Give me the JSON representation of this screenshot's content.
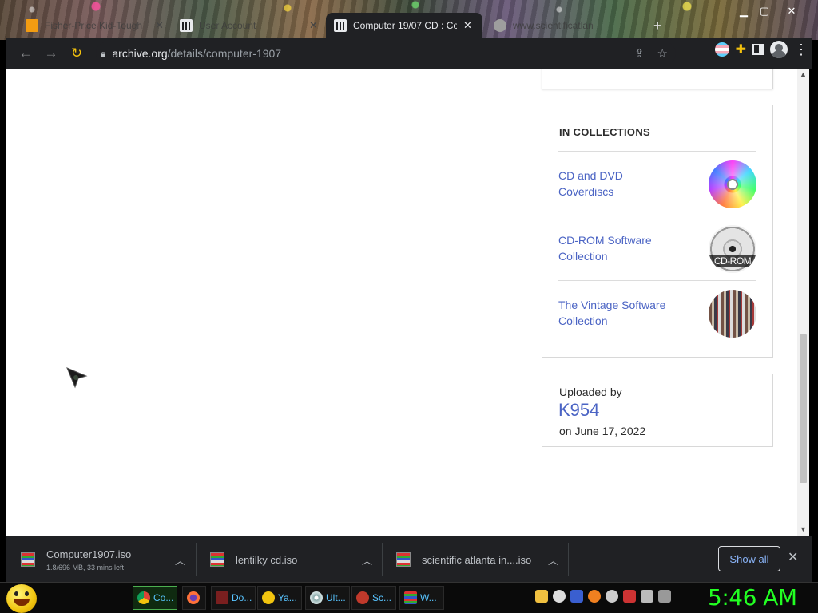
{
  "browser": {
    "tabs": [
      {
        "title": "Fisher-Price Kid-Tough",
        "active": false
      },
      {
        "title": "User Account",
        "active": false
      },
      {
        "title": "Computer 19/07 CD : Co",
        "active": true
      },
      {
        "title": "www.scientificatlan",
        "active": false
      }
    ],
    "new_tab_symbol": "+",
    "url_host": "archive.org",
    "url_path": "/details/computer-1907"
  },
  "page": {
    "collections": {
      "title": "IN COLLECTIONS",
      "items": [
        {
          "label": "CD and DVD Coverdiscs",
          "thumb": "rainbow-disc"
        },
        {
          "label": "CD-ROM Software Collection",
          "thumb": "cd-rom-disc",
          "thumb_text": "CD-ROM"
        },
        {
          "label": "The Vintage Software Collection",
          "thumb": "vintage-software-boxes"
        }
      ]
    },
    "uploaded": {
      "label": "Uploaded by",
      "uploader": "K954",
      "date": "on June 17, 2022"
    }
  },
  "downloads": {
    "items": [
      {
        "name": "Computer1907.iso",
        "status": "1.8/696 MB, 33 mins left"
      },
      {
        "name": "lentilky cd.iso",
        "status": ""
      },
      {
        "name": "scientific atlanta in....iso",
        "status": ""
      }
    ],
    "show_all": "Show all"
  },
  "taskbar": {
    "tasks": [
      {
        "label": "Co...",
        "icon": "chrome-icon"
      },
      {
        "label": "",
        "icon": "firefox-icon"
      },
      {
        "label": "Do...",
        "icon": "document-icon"
      },
      {
        "label": "Ya...",
        "icon": "smiley-icon"
      },
      {
        "label": "Ult...",
        "icon": "disc-icon"
      },
      {
        "label": "Sc...",
        "icon": "screen-recorder-icon"
      },
      {
        "label": "W...",
        "icon": "winrar-icon"
      }
    ],
    "clock": "5:46 AM"
  },
  "colors": {
    "link": "#4b64c4",
    "chrome_dark": "#202124",
    "clock_green": "#22ff22"
  }
}
